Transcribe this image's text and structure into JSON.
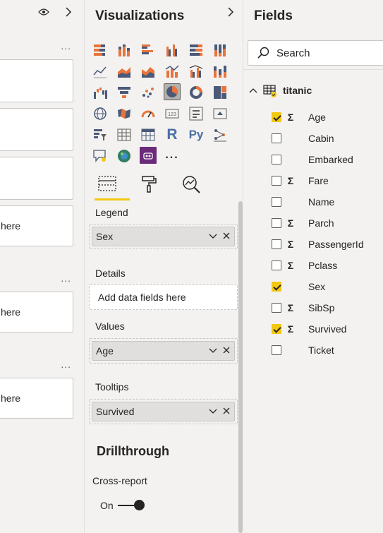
{
  "filters": {
    "eye_icon": "eye-icon",
    "cards": [
      {
        "label": ""
      },
      {
        "label": ""
      },
      {
        "label": ""
      },
      {
        "label": "here"
      },
      {
        "label": "here"
      },
      {
        "label": "here"
      }
    ],
    "more": "..."
  },
  "viz": {
    "title": "Visualizations",
    "icons": [
      "stacked-bar",
      "stacked-column",
      "clustered-bar",
      "clustered-column",
      "100-stacked-bar",
      "100-stacked-column",
      "line",
      "area",
      "stacked-area",
      "line-column",
      "line-clustered-column",
      "ribbon",
      "waterfall",
      "funnel",
      "scatter",
      "pie",
      "donut",
      "treemap",
      "map",
      "filled-map",
      "gauge",
      "card",
      "multi-row-card",
      "kpi",
      "slicer",
      "table",
      "matrix",
      "r-visual",
      "python-visual",
      "key-influencers",
      "qa",
      "arcgis",
      "power-apps"
    ],
    "r_label": "R",
    "py_label": "Py",
    "more_label": "...",
    "wells": {
      "legend_label": "Legend",
      "legend_value": "Sex",
      "details_label": "Details",
      "details_placeholder": "Add data fields here",
      "values_label": "Values",
      "values_value": "Age",
      "tooltips_label": "Tooltips",
      "tooltips_value": "Survived"
    },
    "drillthrough": "Drillthrough",
    "cross_report": "Cross-report",
    "toggle_label": "On"
  },
  "fields": {
    "title": "Fields",
    "search_placeholder": "Search",
    "table_name": "titanic",
    "items": [
      {
        "name": "Age",
        "checked": true,
        "sigma": true
      },
      {
        "name": "Cabin",
        "checked": false,
        "sigma": false
      },
      {
        "name": "Embarked",
        "checked": false,
        "sigma": false
      },
      {
        "name": "Fare",
        "checked": false,
        "sigma": true
      },
      {
        "name": "Name",
        "checked": false,
        "sigma": false
      },
      {
        "name": "Parch",
        "checked": false,
        "sigma": true
      },
      {
        "name": "PassengerId",
        "checked": false,
        "sigma": true
      },
      {
        "name": "Pclass",
        "checked": false,
        "sigma": true
      },
      {
        "name": "Sex",
        "checked": true,
        "sigma": false
      },
      {
        "name": "SibSp",
        "checked": false,
        "sigma": true
      },
      {
        "name": "Survived",
        "checked": true,
        "sigma": true
      },
      {
        "name": "Ticket",
        "checked": false,
        "sigma": false
      }
    ],
    "sigma_symbol": "Σ"
  },
  "colors": {
    "accent": "#f2c811",
    "pane_bg": "#f3f2f1",
    "viz_purple": "#6b2a7a"
  }
}
